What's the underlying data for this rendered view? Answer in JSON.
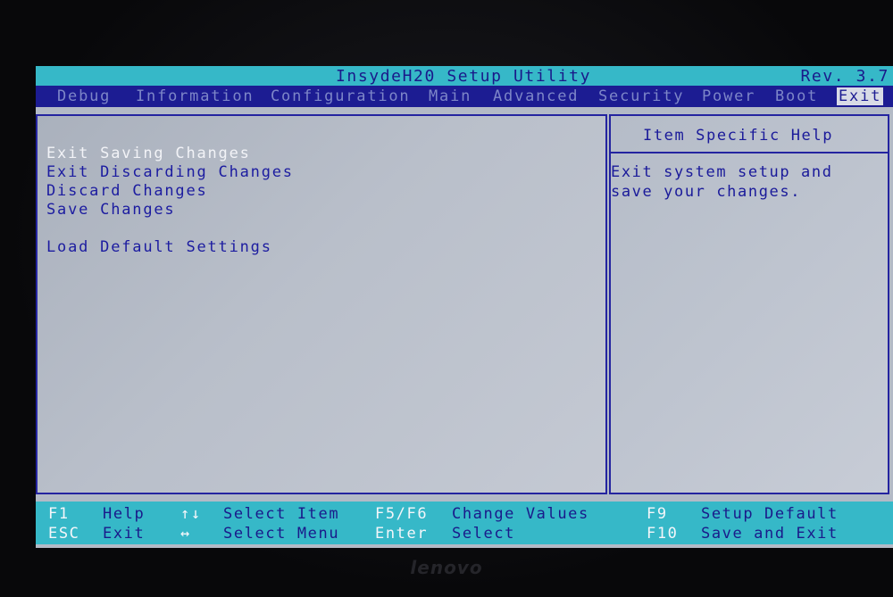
{
  "title_bar": {
    "title": "InsydeH20 Setup Utility",
    "revision": "Rev. 3.7"
  },
  "menu": {
    "tabs": [
      {
        "label": "Debug",
        "active": false
      },
      {
        "label": "Information",
        "active": false
      },
      {
        "label": "Configuration",
        "active": false
      },
      {
        "label": "Main",
        "active": false
      },
      {
        "label": "Advanced",
        "active": false
      },
      {
        "label": "Security",
        "active": false
      },
      {
        "label": "Power",
        "active": false
      },
      {
        "label": "Boot",
        "active": false
      },
      {
        "label": "Exit",
        "active": true
      }
    ]
  },
  "exit_menu": {
    "options": [
      {
        "label": "Exit Saving Changes",
        "selected": true
      },
      {
        "label": "Exit Discarding Changes",
        "selected": false
      },
      {
        "label": "Discard Changes",
        "selected": false
      },
      {
        "label": "Save Changes",
        "selected": false
      },
      {
        "label": "Load Default Settings",
        "selected": false
      }
    ]
  },
  "help": {
    "title": "Item Specific Help",
    "lines": [
      "Exit system setup and",
      "save your changes."
    ]
  },
  "footer": {
    "row1": [
      {
        "key": "F1",
        "desc": "Help"
      },
      {
        "key": "↑↓",
        "desc": "Select Item"
      },
      {
        "key": "F5/F6",
        "desc": "Change Values"
      },
      {
        "key": "F9",
        "desc": "Setup Default"
      }
    ],
    "row2": [
      {
        "key": "ESC",
        "desc": "Exit"
      },
      {
        "key": "↔",
        "desc": "Select Menu"
      },
      {
        "key": "Enter",
        "desc": "Select"
      },
      {
        "key": "F10",
        "desc": "Save and Exit"
      }
    ]
  },
  "brand": "lenovo",
  "colors": {
    "title_bar_bg": "#36b8c8",
    "menu_bar_bg": "#1c1c92",
    "panel_bg": "#b3bac6",
    "text_blue": "#1c1ca0",
    "selected_text": "#f2f3f7"
  }
}
